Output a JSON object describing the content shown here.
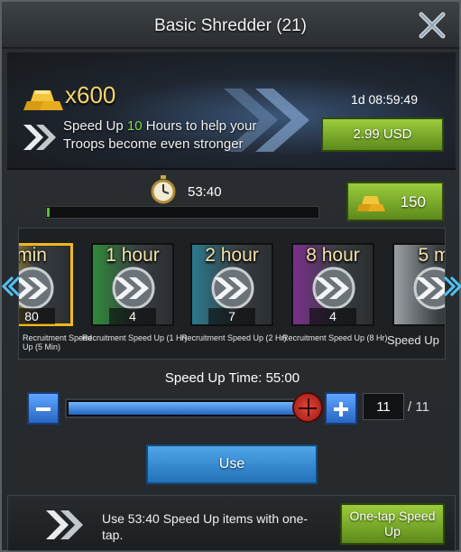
{
  "dialog": {
    "title": "Basic Shredder (21)"
  },
  "offer": {
    "gold_amount": "x600",
    "text_before": "Speed Up ",
    "text_highlight": "10",
    "text_after": " Hours to help your Troops become even stronger",
    "countdown": "1d 08:59:49",
    "price_label": "2.99 USD"
  },
  "training": {
    "remaining_time": "53:40",
    "progress_fraction": 0.01,
    "gold_speedup_cost": "150"
  },
  "items": [
    {
      "header": "min",
      "count": "80",
      "label": "Recruitment Speed Up (5 Min)",
      "selected": true,
      "color": "#e8b21a"
    },
    {
      "header": "1 hour",
      "count": "4",
      "label": "Recruitment Speed Up (1 Hr)",
      "selected": false,
      "color": "#2f8a3a"
    },
    {
      "header": "2 hour",
      "count": "7",
      "label": "Recruitment Speed Up (2 Hr)",
      "selected": false,
      "color": "#2a7a8e"
    },
    {
      "header": "8 hour",
      "count": "4",
      "label": "Recruitment Speed Up (8 Hr)",
      "selected": false,
      "color": "#7a2f8a"
    },
    {
      "header": "5 m",
      "count": "",
      "label": "Speed Up",
      "selected": false,
      "color": "#9aa0a4"
    }
  ],
  "use_panel": {
    "speed_up_time": "Speed Up Time: 55:00",
    "quantity": "11",
    "max_quantity": "/ 11",
    "slider_fraction": 1.0,
    "use_label": "Use"
  },
  "footer": {
    "message": "Use 53:40 Speed Up items with one-tap.",
    "onetap_label": "One-tap Speed Up"
  },
  "icons": {
    "close": "close-icon",
    "gold": "gold-bars-icon",
    "speedup": "chevron-speedup-icon",
    "stopwatch": "stopwatch-icon"
  },
  "colors": {
    "highlight": "#7fe04a",
    "green_button": "#7cae2c",
    "blue_button": "#3a8ed4",
    "gold_text": "#f6d66a"
  }
}
